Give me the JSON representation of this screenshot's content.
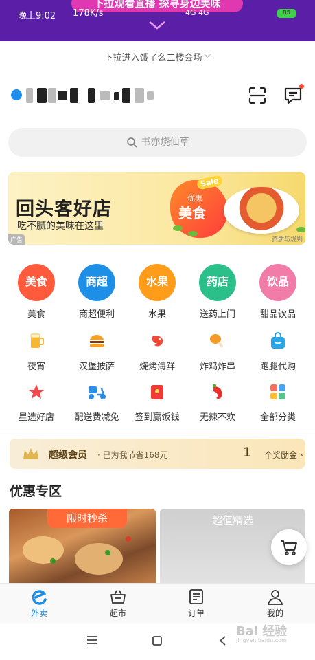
{
  "top_banner": {
    "promo": "下拉观看直播 探寻身边美味",
    "status_time": "晚上9:02",
    "net_speed": "178K/s",
    "signal": "4G 4G",
    "battery": "85"
  },
  "pulldown_hint": "下拉进入饿了么二楼会场",
  "search": {
    "placeholder": "书亦烧仙草"
  },
  "ad_banner": {
    "headline": "回头客好店",
    "subline": "吃不腻的美味在这里",
    "badge_sale": "Sale",
    "badge_top": "优惠",
    "badge_main": "美食",
    "ad_tag": "广告",
    "rules": "资质与规则"
  },
  "categories_primary": [
    {
      "circle": "美食",
      "label": "美食",
      "color": "#ff5a3c"
    },
    {
      "circle": "商超",
      "label": "商超便利",
      "color": "#1e8fe6"
    },
    {
      "circle": "水果",
      "label": "水果",
      "color": "#ff9c1a"
    },
    {
      "circle": "药店",
      "label": "送药上门",
      "color": "#2bbf8a"
    },
    {
      "circle": "饮品",
      "label": "甜品饮品",
      "color": "#f27ca8"
    }
  ],
  "categories_secondary": [
    {
      "label": "夜宵",
      "icon": "beer-icon"
    },
    {
      "label": "汉堡披萨",
      "icon": "burger-icon"
    },
    {
      "label": "烧烤海鲜",
      "icon": "shrimp-icon"
    },
    {
      "label": "炸鸡炸串",
      "icon": "drumstick-icon"
    },
    {
      "label": "跑腿代购",
      "icon": "bag-icon"
    },
    {
      "label": "星选好店",
      "icon": "star-icon"
    },
    {
      "label": "配送费减免",
      "icon": "scooter-icon"
    },
    {
      "label": "签到赢饭钱",
      "icon": "redpacket-icon"
    },
    {
      "label": "无辣不欢",
      "icon": "chili-icon"
    },
    {
      "label": "全部分类",
      "icon": "grid-icon"
    }
  ],
  "member": {
    "title": "超级会员",
    "desc": "· 已为我节省168元",
    "count": "1",
    "reward": "个奖励金 ›"
  },
  "section_title": "优惠专区",
  "cards": {
    "flash": "限时秒杀",
    "selected": "超值精选"
  },
  "tabs": [
    {
      "label": "外卖",
      "active": true
    },
    {
      "label": "超市",
      "active": false
    },
    {
      "label": "订单",
      "active": false
    },
    {
      "label": "我的",
      "active": false
    }
  ],
  "watermark": {
    "main": "Bai 经验",
    "sub": "jingyan.baidu.com"
  },
  "colors": {
    "accent": "#1f8de6",
    "banner": "#5b1fa7",
    "promo": "#e83ab2"
  }
}
